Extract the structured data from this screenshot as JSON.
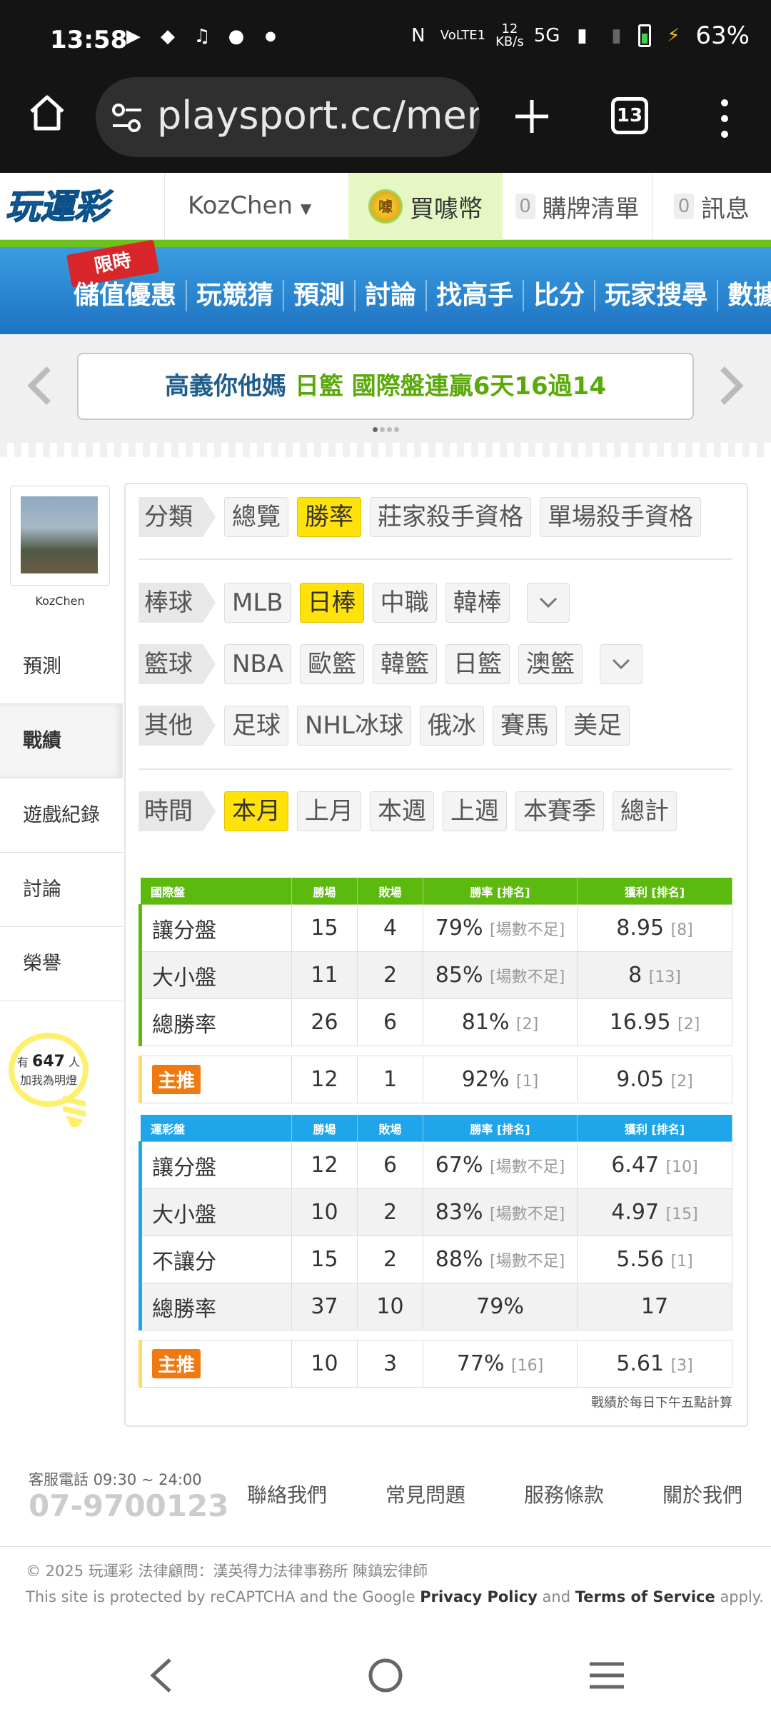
{
  "status_bar": {
    "time": "13:58",
    "net_speed_top": "12",
    "net_speed_bottom": "KB/s",
    "network": "5G",
    "volte": "VoLTE1",
    "battery": "63%"
  },
  "browser": {
    "url": "playsport.cc/mer",
    "tab_count": "13"
  },
  "site_nav": {
    "logo": "玩運彩",
    "username": "KozChen",
    "buy_coin": "買噱幣",
    "coin_icon_text": "噱",
    "cart_count": "0",
    "cart_label": "購牌清單",
    "msg_count": "0",
    "msg_label": "訊息"
  },
  "menu": {
    "limited": "限時",
    "items": [
      "儲值優惠",
      "玩競猜",
      "預測",
      "討論",
      "找高手",
      "比分",
      "玩家搜尋",
      "數據"
    ]
  },
  "banner": {
    "part1": "高義你他媽",
    "part2": "日籃 國際盤連贏6天16過14"
  },
  "profile": {
    "nickname": "KozChen",
    "fans_prefix": "有",
    "fans_count": "647",
    "fans_suffix": "人",
    "fans_line2": "加我為明燈"
  },
  "side_menu": [
    "預測",
    "戰績",
    "遊戲紀錄",
    "討論",
    "榮譽"
  ],
  "filters": {
    "category": {
      "label": "分類",
      "options": [
        "總覽",
        "勝率",
        "莊家殺手資格",
        "單場殺手資格"
      ],
      "selected": "勝率"
    },
    "baseball": {
      "label": "棒球",
      "options": [
        "MLB",
        "日棒",
        "中職",
        "韓棒"
      ],
      "selected": "日棒"
    },
    "basketball": {
      "label": "籃球",
      "options": [
        "NBA",
        "歐籃",
        "韓籃",
        "日籃",
        "澳籃"
      ]
    },
    "other": {
      "label": "其他",
      "options": [
        "足球",
        "NHL冰球",
        "俄冰",
        "賽馬",
        "美足"
      ]
    },
    "time": {
      "label": "時間",
      "options": [
        "本月",
        "上月",
        "本週",
        "上週",
        "本賽季",
        "總計"
      ],
      "selected": "本月"
    }
  },
  "intl_table": {
    "headers": [
      "國際盤",
      "勝場",
      "敗場",
      "勝率 [排名]",
      "獲利 [排名]"
    ],
    "rows": [
      {
        "name": "讓分盤",
        "w": "15",
        "l": "4",
        "rate": "79%",
        "rate_rank": "[場數不足]",
        "profit": "8.95",
        "profit_rank": "[8]"
      },
      {
        "name": "大小盤",
        "w": "11",
        "l": "2",
        "rate": "85%",
        "rate_rank": "[場數不足]",
        "profit": "8",
        "profit_rank": "[13]"
      },
      {
        "name": "總勝率",
        "w": "26",
        "l": "6",
        "rate": "81%",
        "rate_rank": "[2]",
        "profit": "16.95",
        "profit_rank": "[2]"
      }
    ],
    "push": {
      "name": "主推",
      "w": "12",
      "l": "1",
      "rate": "92%",
      "rate_rank": "[1]",
      "profit": "9.05",
      "profit_rank": "[2]"
    }
  },
  "lottery_table": {
    "headers": [
      "運彩盤",
      "勝場",
      "敗場",
      "勝率 [排名]",
      "獲利 [排名]"
    ],
    "rows": [
      {
        "name": "讓分盤",
        "w": "12",
        "l": "6",
        "rate": "67%",
        "rate_rank": "[場數不足]",
        "profit": "6.47",
        "profit_rank": "[10]"
      },
      {
        "name": "大小盤",
        "w": "10",
        "l": "2",
        "rate": "83%",
        "rate_rank": "[場數不足]",
        "profit": "4.97",
        "profit_rank": "[15]"
      },
      {
        "name": "不讓分",
        "w": "15",
        "l": "2",
        "rate": "88%",
        "rate_rank": "[場數不足]",
        "profit": "5.56",
        "profit_rank": "[1]"
      },
      {
        "name": "總勝率",
        "w": "37",
        "l": "10",
        "rate": "79%",
        "rate_rank": "",
        "profit": "17",
        "profit_rank": ""
      }
    ],
    "push": {
      "name": "主推",
      "w": "10",
      "l": "3",
      "rate": "77%",
      "rate_rank": "[16]",
      "profit": "5.61",
      "profit_rank": "[3]"
    }
  },
  "note": "戰績於每日下午五點計算",
  "footer": {
    "hotline": "客服電話 09:30 ~ 24:00",
    "phone": "07-9700123",
    "links": [
      "聯絡我們",
      "常見問題",
      "服務條款",
      "關於我們"
    ],
    "copyright": "© 2025 玩運彩 法律顧問：漢英得力法律事務所 陳鎮宏律師",
    "recaptcha_pre": "This site is protected by reCAPTCHA and the Google",
    "privacy": "Privacy Policy",
    "and": "and",
    "terms": "Terms of Service",
    "apply": "apply."
  },
  "colors": {
    "green": "#5cb90d",
    "blue": "#1fa6ea",
    "highlight": "#ffe20a",
    "push": "#f07a12"
  }
}
